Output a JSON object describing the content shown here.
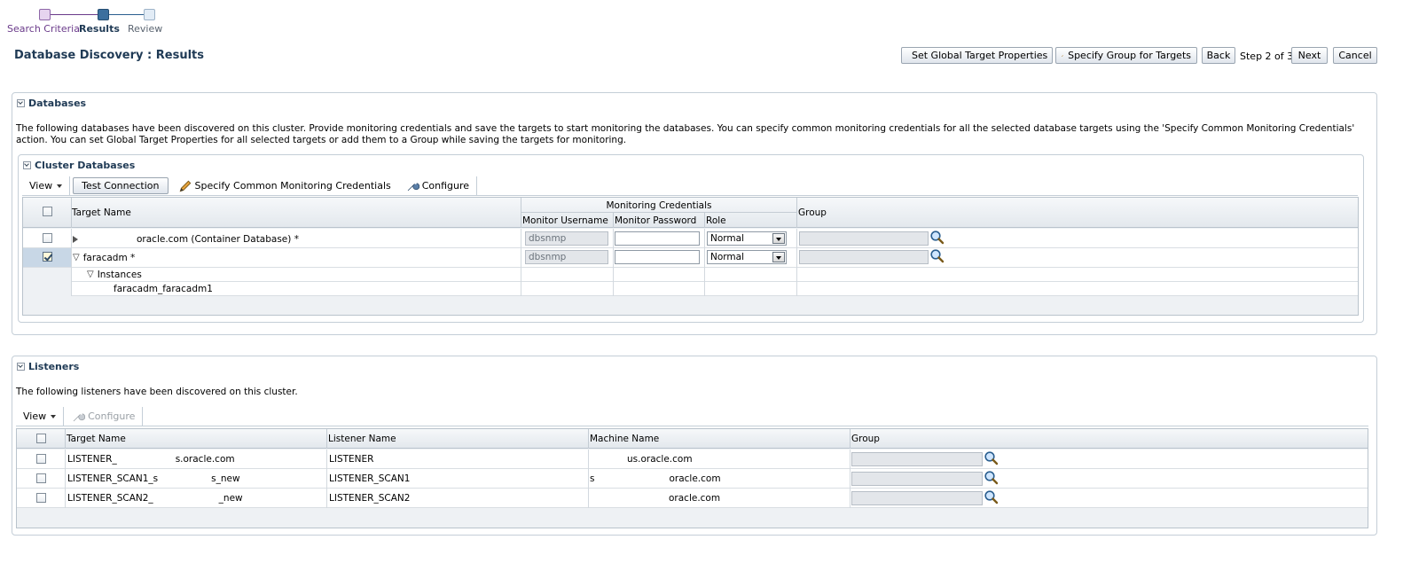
{
  "train": {
    "steps": [
      {
        "label": "Search Criteria",
        "state": "visited"
      },
      {
        "label": "Results",
        "state": "current"
      },
      {
        "label": "Review",
        "state": "future"
      }
    ]
  },
  "header": {
    "title": "Database Discovery : Results",
    "set_global_label": "Set Global Target Properties",
    "specify_group_label": "Specify Group for Targets",
    "back_label": "Back",
    "step_text": "Step 2 of 3",
    "next_label": "Next",
    "cancel_label": "Cancel"
  },
  "databases": {
    "title": "Databases",
    "description": "The following databases have been discovered on this cluster. Provide monitoring credentials and save the targets to start monitoring the databases. You can specify common monitoring credentials for all the selected database targets using the 'Specify Common Monitoring Credentials' action. You can set Global Target Properties for all selected targets or add them to a Group while saving the targets for monitoring.",
    "cluster": {
      "title": "Cluster Databases",
      "toolbar": {
        "view_label": "View",
        "test_connection_label": "Test Connection",
        "specify_creds_label": "Specify Common Monitoring Credentials",
        "configure_label": "Configure"
      },
      "columns": {
        "target_name": "Target Name",
        "monitoring_credentials": "Monitoring Credentials",
        "monitor_username": "Monitor Username",
        "monitor_password": "Monitor Password",
        "role": "Role",
        "group": "Group"
      },
      "rows": [
        {
          "target_name": "oracle.com (Container Database) *",
          "username": "dbsnmp",
          "role": "Normal",
          "checked": false
        },
        {
          "target_name": "faracadm *",
          "username": "dbsnmp",
          "role": "Normal",
          "checked": true
        }
      ],
      "instances_label": "Instances",
      "instance_name": "faracadm_faracadm1"
    }
  },
  "listeners": {
    "title": "Listeners",
    "description": "The following listeners have been discovered on this cluster.",
    "toolbar": {
      "view_label": "View",
      "configure_label": "Configure"
    },
    "columns": {
      "target_name": "Target Name",
      "listener_name": "Listener Name",
      "machine_name": "Machine Name",
      "group": "Group"
    },
    "rows": [
      {
        "target_a": "LISTENER_",
        "target_b": "s.oracle.com",
        "listener": "LISTENER",
        "machine": "us.oracle.com"
      },
      {
        "target_a": "LISTENER_SCAN1_s",
        "target_b": "s_new",
        "listener": "LISTENER_SCAN1",
        "machine": "oracle.com",
        "machine_prefix": "s"
      },
      {
        "target_a": "LISTENER_SCAN2_",
        "target_b": "_new",
        "listener": "LISTENER_SCAN2",
        "machine": "oracle.com"
      }
    ]
  },
  "colors": {
    "accent_dark": "#1f3a55",
    "train_visited": "#6a3a8a",
    "train_current": "#2a5e8f"
  }
}
